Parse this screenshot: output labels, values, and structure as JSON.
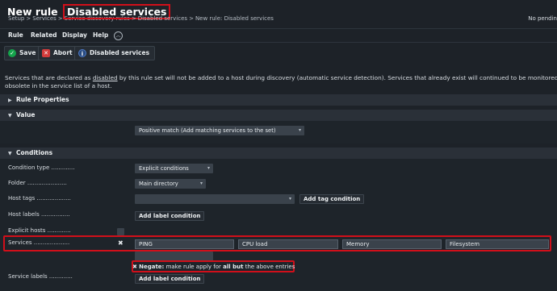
{
  "header": {
    "title_prefix": "New rule",
    "title_highlight": "Disabled services",
    "breadcrumb": [
      "Setup",
      "Services",
      "Service discovery rules",
      "Disabled services",
      "New rule: Disabled services"
    ],
    "breadcrumb_sep": ">",
    "pending": "No pendin"
  },
  "menu": {
    "items": [
      "Rule",
      "Related",
      "Display",
      "Help"
    ],
    "collapse_icon": "chevron-up-icon"
  },
  "toolbar": {
    "save_label": "Save",
    "abort_label": "Abort",
    "disabled_services_label": "Disabled services"
  },
  "description": {
    "line1_a": "Services that are declared as ",
    "line1_underlined": "disabled",
    "line1_b": " by this rule set will not be added to a host during discovery (automatic service detection). Services that already exist will continued to be monitored but be ma",
    "line2": "obsolete in the service list of a host."
  },
  "sections": {
    "rule_properties": "Rule Properties",
    "value": "Value",
    "conditions": "Conditions"
  },
  "value": {
    "selected": "Positive match (Add matching services to the set)"
  },
  "conditions": {
    "condition_type_label": "Condition type",
    "condition_type_value": "Explicit conditions",
    "folder_label": "Folder",
    "folder_value": "Main directory",
    "host_tags_label": "Host tags",
    "add_tag_condition": "Add tag condition",
    "host_labels_label": "Host labels",
    "add_label_condition": "Add label condition",
    "explicit_hosts_label": "Explicit hosts",
    "services_label": "Services",
    "services": [
      "PING",
      "CPU load",
      "Memory",
      "Filesystem"
    ],
    "negate_bold": "Negate:",
    "negate_a": " make rule apply for ",
    "negate_bold2": "all but",
    "negate_b": " the above entries",
    "service_labels_label": "Service labels",
    "add_label_condition_2": "Add label condition"
  },
  "colors": {
    "highlight": "#d10f1a",
    "background": "#1d2228",
    "save_icon": "#14a34b",
    "abort_icon": "#d33b3b"
  }
}
